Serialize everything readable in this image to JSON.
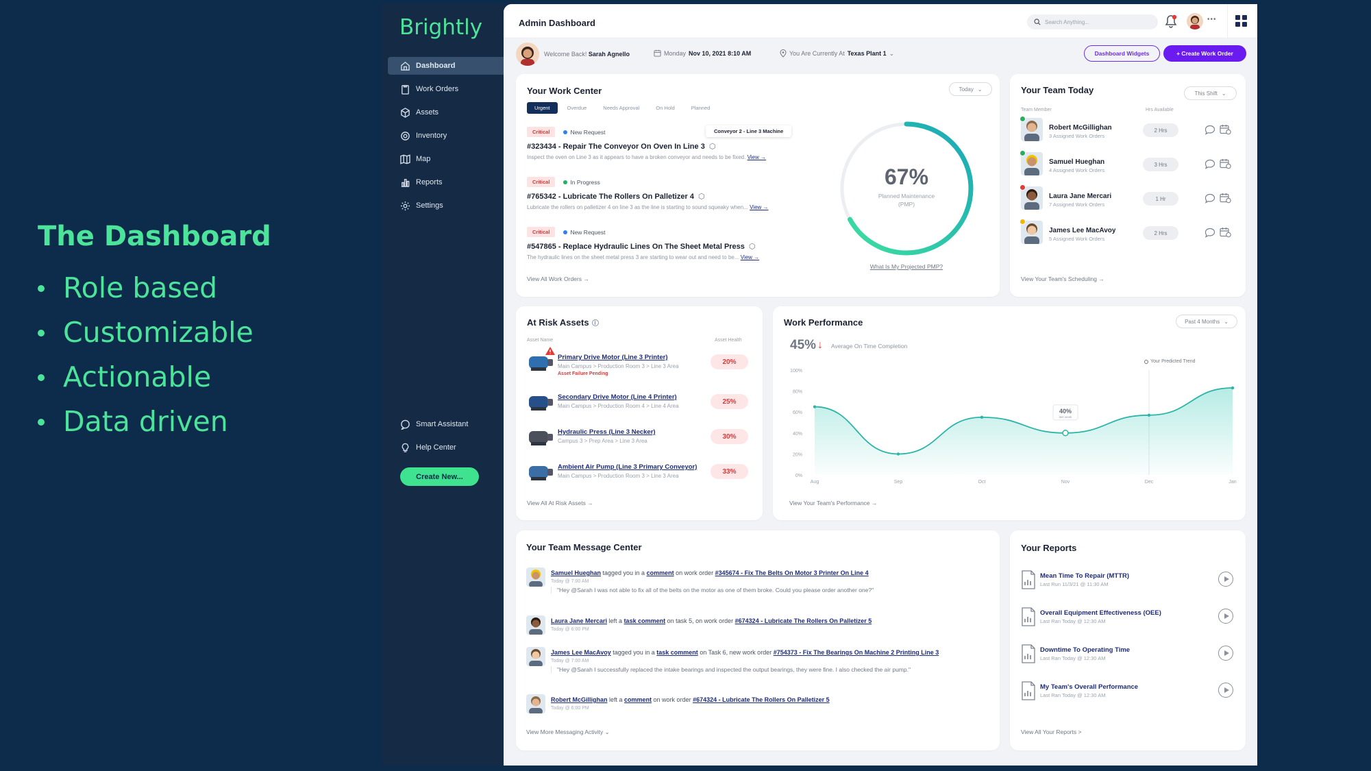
{
  "slide": {
    "title": "The Dashboard",
    "bullets": [
      "Role based",
      "Customizable",
      "Actionable",
      "Data driven"
    ]
  },
  "sidebar": {
    "brand": "Brightly",
    "items": [
      {
        "label": "Dashboard",
        "icon": "home-icon"
      },
      {
        "label": "Work Orders",
        "icon": "clipboard-icon"
      },
      {
        "label": "Assets",
        "icon": "cube-icon"
      },
      {
        "label": "Inventory",
        "icon": "gear-icon"
      },
      {
        "label": "Map",
        "icon": "map-icon"
      },
      {
        "label": "Reports",
        "icon": "bar-chart-icon"
      },
      {
        "label": "Settings",
        "icon": "settings-icon"
      }
    ],
    "bottom_items": [
      {
        "label": "Smart Assistant",
        "icon": "chat-icon"
      },
      {
        "label": "Help Center",
        "icon": "lightbulb-icon"
      }
    ],
    "create_new": "Create New..."
  },
  "topbar": {
    "title": "Admin Dashboard",
    "search_placeholder": "Search Anything...",
    "more": "•••"
  },
  "welcome": {
    "prefix": "Welcome Back!",
    "name": "Sarah Agnello",
    "day": "Monday",
    "date": "Nov 10, 2021 8:10 AM",
    "location_prefix": "You Are Currently At",
    "location": "Texas Plant 1",
    "widgets_button": "Dashboard Widgets",
    "create_wo_button": "+ Create Work Order"
  },
  "work_center": {
    "title": "Your Work Center",
    "filter": "Today",
    "tabs": [
      "Urgent",
      "Overdue",
      "Needs Approval",
      "On Hold",
      "Planned"
    ],
    "tooltip": "Conveyor 2 - Line 3 Machine",
    "orders": [
      {
        "priority": "Critical",
        "status": "New Request",
        "status_color": "#2f80ed",
        "title": "#323434 - Repair The Conveyor On Oven In Line 3",
        "desc": "Inspect the oven on Line 3 as it appears to have a broken conveyor and needs to be fixed.",
        "view": "View →"
      },
      {
        "priority": "Critical",
        "status": "In Progress",
        "status_color": "#27ae60",
        "title": "#765342 - Lubricate The Rollers On Palletizer 4",
        "desc": "Lubricate the rollers on palletizer 4 on line 3 as the line is starting to sound squeaky when...",
        "view": "View →"
      },
      {
        "priority": "Critical",
        "status": "New Request",
        "status_color": "#2f80ed",
        "title": "#547865 - Replace Hydraulic Lines On The Sheet Metal Press",
        "desc": "The hydraulic lines on the sheet metal press 3 are starting to wear out and need to be...",
        "view": "View →"
      }
    ],
    "view_all": "View All Work Orders →",
    "pmp_percent": "67%",
    "pmp_label": "Planned Maintenance",
    "pmp_abbr": "(PMP)",
    "pmp_value": 0.67,
    "pmp_link": "What Is My Projected PMP?"
  },
  "team_today": {
    "title": "Your Team Today",
    "filter": "This Shift",
    "col_member": "Team Member",
    "col_available": "Hrs Available",
    "members": [
      {
        "name": "Robert McGillighan",
        "orders": "3 Assigned Work Orders",
        "hrs": "2 Hrs",
        "status_color": "#27ae60",
        "skin": "#e2b48f",
        "hair": "#8a6a4a"
      },
      {
        "name": "Samuel Hueghan",
        "orders": "4 Assigned Work Orders",
        "hrs": "3 Hrs",
        "status_color": "#27ae60",
        "skin": "#c8936a",
        "hair": "#f2c200"
      },
      {
        "name": "Laura Jane Mercari",
        "orders": "7 Assigned Work Orders",
        "hrs": "1 Hr",
        "status_color": "#e53935",
        "skin": "#8c5a3c",
        "hair": "#2b1a10"
      },
      {
        "name": "James Lee MacAvoy",
        "orders": "5 Assigned Work Orders",
        "hrs": "2 Hrs",
        "status_color": "#f2b705",
        "skin": "#f0c7a4",
        "hair": "#6b4a2e"
      }
    ],
    "view_link": "View Your Team's Scheduling →"
  },
  "at_risk": {
    "title": "At Risk Assets",
    "col_name": "Asset Name",
    "col_health": "Asset Health",
    "assets": [
      {
        "name": "Primary Drive Motor (Line 3 Printer)",
        "loc": "Main Campus > Production Room 3 > Line 3 Area",
        "alert": "Asset Failure Pending",
        "health": "20%"
      },
      {
        "name": "Secondary Drive Motor (Line 4 Printer)",
        "loc": "Main Campus > Production Room 4 > Line 4 Area",
        "alert": "",
        "health": "25%"
      },
      {
        "name": "Hydraulic Press (Line 3 Necker)",
        "loc": "Campus 3 > Prep Area > Line 3 Area",
        "alert": "",
        "health": "30%"
      },
      {
        "name": "Ambient Air Pump (Line 3 Primary Conveyor)",
        "loc": "Main Campus > Production Room 3 > Line 3 Area",
        "alert": "",
        "health": "33%"
      }
    ],
    "view_all": "View All At Risk Assets →"
  },
  "performance": {
    "title": "Work Performance",
    "filter": "Past 4 Months",
    "big": "45%",
    "label": "Average On Time Completion",
    "legend": "Your Predicted Trend",
    "callout": "40%",
    "callout_sub": "last week",
    "view_link": "View Your Team's Performance →"
  },
  "chart_data": {
    "type": "area",
    "title": "",
    "x": [
      "Aug",
      "Sep",
      "Oct",
      "Nov",
      "Dec",
      "Jan"
    ],
    "series": [
      {
        "name": "Your Predicted Trend",
        "values": [
          65,
          20,
          55,
          40,
          57,
          83
        ]
      }
    ],
    "yticks": [
      "0%",
      "20%",
      "40%",
      "60%",
      "80%",
      "100%"
    ],
    "ylim": [
      0,
      100
    ],
    "grid": false,
    "legend": "top-right",
    "color": "#2bb5a8"
  },
  "messages": {
    "title": "Your Team Message Center",
    "items": [
      {
        "user": "Samuel Hueghan",
        "pre": " tagged you in a ",
        "kind": "comment",
        "mid": " on work order ",
        "order": "#345674 - Fix The Belts On Motor 3 Printer On Line 4",
        "time": "Today @ 7:00 AM",
        "quote": "\"Hey @Sarah I was not able to fix all of the belts on the motor as one of them broke. Could you please order another one?\""
      },
      {
        "user": "Laura Jane Mercari",
        "pre": " left a ",
        "kind": "task comment",
        "mid": " on task 5, on work order ",
        "order": "#674324 - Lubricate The Rollers On Palletizer 5",
        "time": "Today @ 6:00 PM",
        "quote": ""
      },
      {
        "user": "James Lee MacAvoy",
        "pre": " tagged you in a ",
        "kind": "task comment",
        "mid": " on Task 6, new work order ",
        "order": "#754373 - Fix The Bearings On Machine 2 Printing Line 3",
        "time": "Today @ 7:00 AM",
        "quote": "\"Hey @Sarah I successfully replaced the intake bearings and inspected the output bearings, they were fine. I also checked the air pump.\""
      },
      {
        "user": "Robert McGillighan",
        "pre": " left a ",
        "kind": "comment",
        "mid": " on work order ",
        "order": "#674324 - Lubricate The Rollers On Palletizer 5",
        "time": "Today @ 6:00 PM",
        "quote": ""
      }
    ],
    "view_more": "View More Messaging Activity"
  },
  "reports": {
    "title": "Your Reports",
    "items": [
      {
        "name": "Mean Time To Repair (MTTR)",
        "last": "Last Run 11/3/21 @ 11:30 AM"
      },
      {
        "name": "Overall Equipment Effectiveness (OEE)",
        "last": "Last Ran Today @ 12:30 AM"
      },
      {
        "name": "Downtime To Operating Time",
        "last": "Last Ran Today @ 12:30 AM"
      },
      {
        "name": "My Team's Overall Performance",
        "last": "Last Ran Today @ 12:30 AM"
      }
    ],
    "view_all": "View All Your Reports >"
  }
}
